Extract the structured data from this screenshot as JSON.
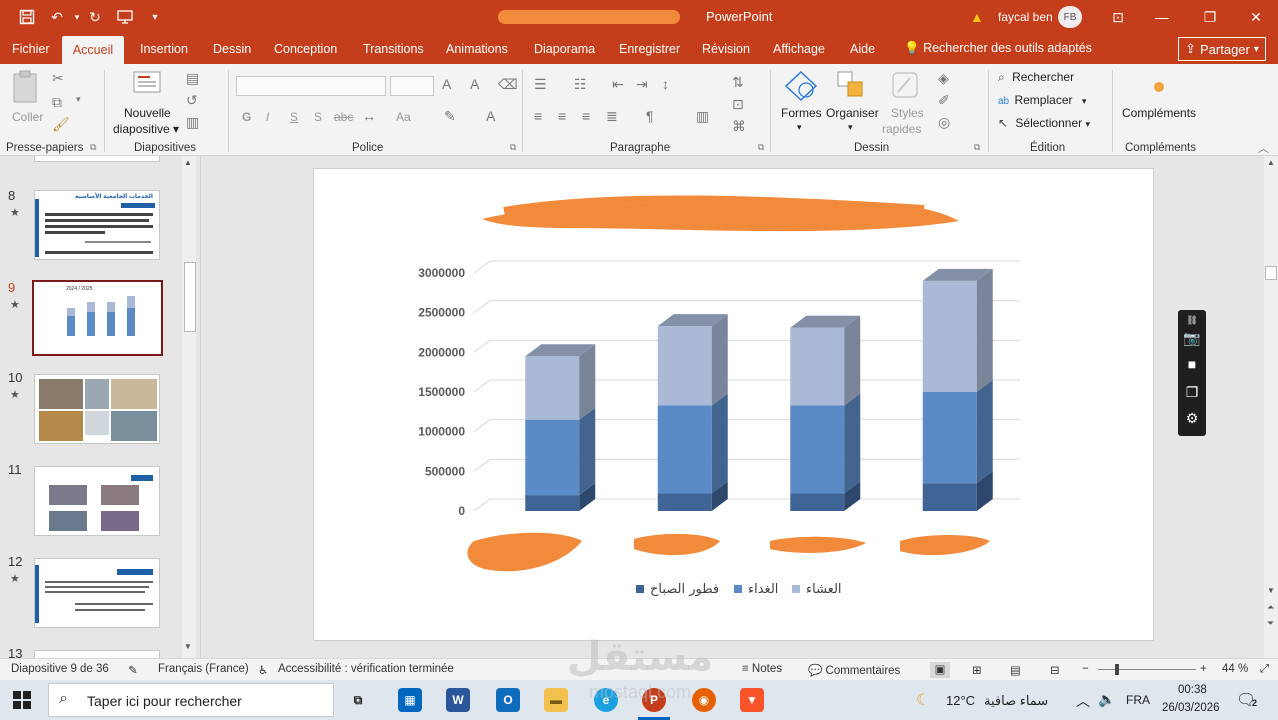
{
  "titlebar": {
    "app_title": "PowerPoint",
    "user_name": "faycal ben",
    "avatar_initials": "FB",
    "colors": {
      "background": "#c43e1c"
    }
  },
  "ribbon_tabs": {
    "tabs": [
      "Fichier",
      "Accueil",
      "Insertion",
      "Dessin",
      "Conception",
      "Transitions",
      "Animations",
      "Diaporama",
      "Enregistrer",
      "Révision",
      "Affichage",
      "Aide"
    ],
    "active": "Accueil",
    "search_label": "Rechercher des outils adaptés",
    "share_label": "Partager"
  },
  "ribbon": {
    "clipboard": {
      "paste_label": "Coller",
      "group_label": "Presse-papiers"
    },
    "slides": {
      "new_slide_line1": "Nouvelle",
      "new_slide_line2": "diapositive",
      "group_label": "Diapositives"
    },
    "font": {
      "bold": "G",
      "italic": "I",
      "underline": "S",
      "shadow": "S",
      "strike": "abc",
      "case": "Aa",
      "group_label": "Police"
    },
    "paragraph": {
      "group_label": "Paragraphe"
    },
    "drawing": {
      "shapes_label": "Formes",
      "arrange_label": "Organiser",
      "styles_line1": "Styles",
      "styles_line2": "rapides",
      "group_label": "Dessin"
    },
    "editing": {
      "find_label": "Rechercher",
      "replace_label": "Remplacer",
      "select_label": "Sélectionner",
      "group_label": "Édition"
    },
    "addins": {
      "label": "Compléments",
      "group_label": "Compléments"
    }
  },
  "thumbnails": {
    "slides": [
      {
        "number": "8",
        "starred": true
      },
      {
        "number": "9",
        "starred": true,
        "selected": true
      },
      {
        "number": "10",
        "starred": true
      },
      {
        "number": "11",
        "starred": false
      },
      {
        "number": "12",
        "starred": true
      },
      {
        "number": "13",
        "starred": false
      }
    ],
    "thumb8_title": "الخدمات الجامعية الأساسية",
    "thumb9_title": "2024 / 2025"
  },
  "chart_data": {
    "type": "bar",
    "stacked": true,
    "three_d": true,
    "title": "",
    "categories": [
      "",
      "",
      "",
      ""
    ],
    "series": [
      {
        "name": "فطور الصباح",
        "color": "#3f6496",
        "values": [
          200000,
          220000,
          220000,
          350000
        ]
      },
      {
        "name": "الغداء",
        "color": "#5b8bc7",
        "values": [
          950000,
          1110000,
          1110000,
          1150000
        ]
      },
      {
        "name": "العشاء",
        "color": "#a9b9d6",
        "values": [
          800000,
          1000000,
          980000,
          1400000
        ]
      }
    ],
    "yticks": [
      "0",
      "500000",
      "1000000",
      "1500000",
      "2000000",
      "2500000",
      "3000000"
    ],
    "ylim": [
      0,
      3000000
    ],
    "grid": true,
    "legend_position": "bottom"
  },
  "statusbar": {
    "slide_info": "Diapositive 9 de 36",
    "language": "Français (France)",
    "accessibility": "Accessibilité : vérification terminée",
    "notes_label": "Notes",
    "comments_label": "Commentaires",
    "zoom": "44 %"
  },
  "taskbar": {
    "search_placeholder": "Taper ici pour rechercher",
    "weather_temp": "12°C",
    "weather_desc": "سماء صافية",
    "lang": "FRA",
    "time": "00:38",
    "date": "26/03/2026",
    "notif_count": "2"
  },
  "watermark": {
    "text": "مستقل",
    "sub": "mostaql.com"
  }
}
